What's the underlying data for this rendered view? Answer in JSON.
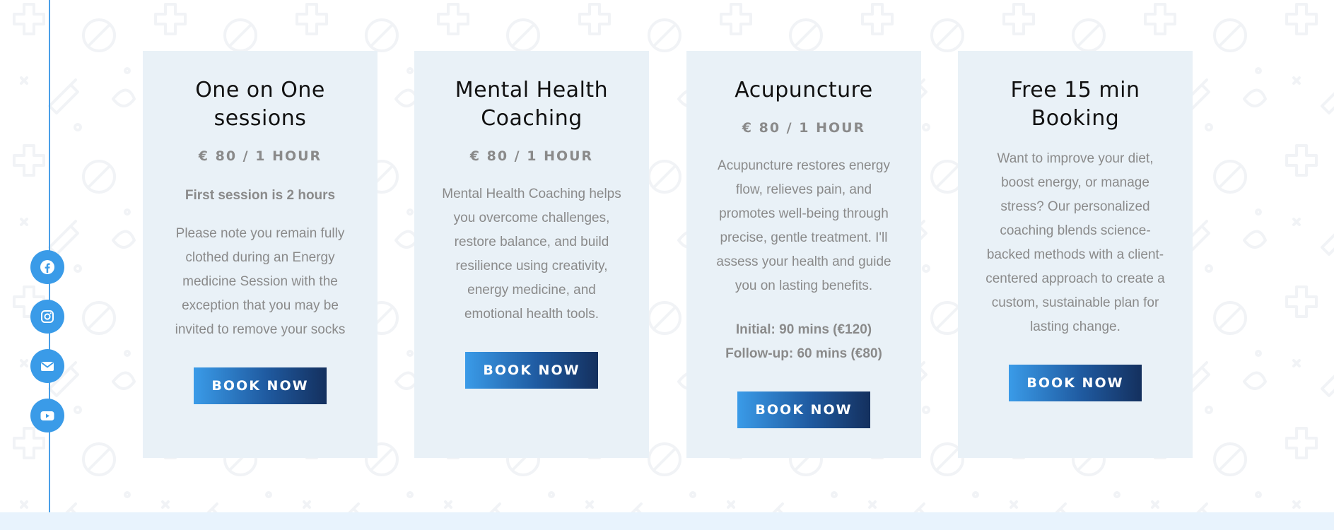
{
  "social": [
    {
      "name": "facebook-icon",
      "color": "#3a9be8"
    },
    {
      "name": "instagram-icon",
      "color": "#3a9be8"
    },
    {
      "name": "email-icon",
      "color": "#3a9be8"
    },
    {
      "name": "youtube-icon",
      "color": "#3a9be8"
    }
  ],
  "colors": {
    "card_bg": "#e9f1f7",
    "accent": "#3a9be8",
    "button_dark": "#14305e",
    "text_muted": "#8a8a8a"
  },
  "cards": [
    {
      "title": "One on One sessions",
      "price": "€ 80 / 1 HOUR",
      "note": "First session is 2 hours",
      "description": "Please note you remain fully clothed during an Energy medicine Session with the exception that you may be invited to remove your socks",
      "button": "BOOK NOW"
    },
    {
      "title": "Mental Health Coaching",
      "price": "€ 80 / 1 HOUR",
      "description": "Mental Health Coaching helps you overcome challenges, restore balance, and build resilience using creativity, energy medicine, and emotional health tools.",
      "button": "BOOK NOW"
    },
    {
      "title": "Acupuncture",
      "price": "€ 80 / 1 HOUR",
      "description": "Acupuncture restores energy flow, relieves pain, and promotes well-being through precise, gentle treatment. I'll assess your health and guide you on lasting benefits.",
      "detail_initial": "Initial: 90 mins (€120)",
      "detail_followup": "Follow-up: 60 mins (€80)",
      "button": "BOOK NOW"
    },
    {
      "title": "Free 15 min Booking",
      "description": "Want to improve your diet, boost energy, or manage stress? Our personalized coaching blends science-backed methods with a client-centered approach to create a custom, sustainable plan for lasting change.",
      "button": "BOOK NOW"
    }
  ]
}
